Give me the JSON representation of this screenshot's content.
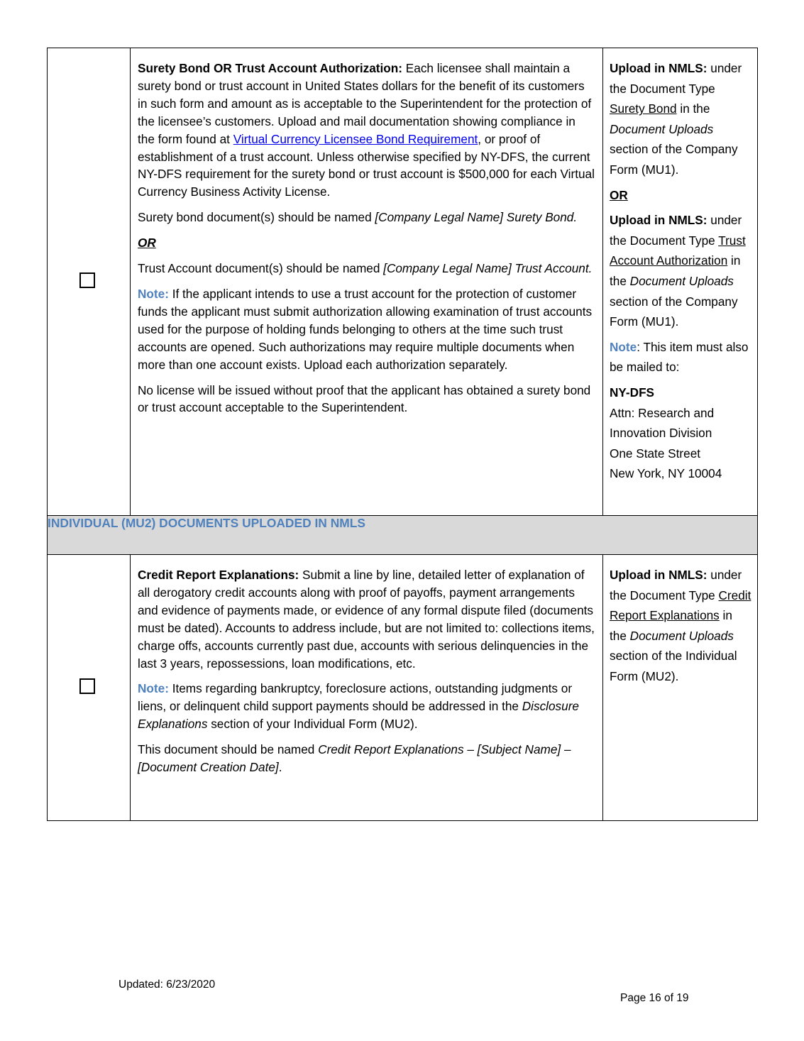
{
  "rows": [
    {
      "checkbox_checked": false,
      "description": {
        "title": "Surety Bond OR Trust Account Authorization:",
        "intro_before_link": " Each licensee shall maintain a surety bond or trust account in United States dollars for the benefit of its customers in such form and amount as is acceptable to the Superintendent for the protection of the licensee’s customers.  Upload and mail documentation showing compliance in the form found at ",
        "link_text": "Virtual Currency Licensee Bond Requirement",
        "intro_after_link": ", or proof of establishment of a trust account.  Unless otherwise specified by NY-DFS, the current NY-DFS requirement for the surety bond or trust account is $500,000 for each Virtual Currency Business Activity License.",
        "surety_naming_prefix": "Surety bond document(s) should be named ",
        "surety_naming_name": "[Company Legal Name] Surety Bond.",
        "or_label": "OR",
        "trust_naming_prefix": "Trust Account document(s) should be named ",
        "trust_naming_name": "[Company Legal Name] Trust Account.",
        "note_label": "Note:",
        "note_text": " If the applicant intends to use a trust account for the protection of customer funds the applicant must submit authorization allowing examination of trust accounts used for the purpose of holding funds belonging to others at the time such trust accounts are opened.  Such authorizations may require multiple documents when more than one account exists.  Upload each authorization separately.",
        "closing": "No license will be issued without proof that the applicant has obtained a surety bond or trust account acceptable to the Superintendent."
      },
      "upload": {
        "label1": "Upload in NMLS:",
        "text1a": " under the Document Type ",
        "doc_type1": "Surety Bond",
        "text1b": " in the ",
        "section1": "Document Uploads",
        "text1c": " section of the Company Form (MU1).",
        "or_label": "OR",
        "label2": "Upload in NMLS:",
        "text2a": " under the Document Type ",
        "doc_type2": "Trust Account Authorization",
        "text2b": " in the ",
        "section2": "Document Uploads",
        "text2c": " section of the Company Form (MU1).",
        "note_label": "Note",
        "note_text": ": This item must also be mailed to:",
        "address": {
          "org": "NY-DFS",
          "line1": "Attn: Research and Innovation Division",
          "line2": "One State Street",
          "line3": "New York, NY 10004"
        }
      }
    },
    {
      "checkbox_checked": false,
      "description": {
        "title": "Credit Report Explanations:",
        "intro": " Submit a line by line, detailed letter of explanation of all derogatory credit accounts along with proof of payoffs, payment arrangements and evidence of payments made, or evidence of any formal dispute filed (documents must be dated).  Accounts to address include, but are not limited to: collections items, charge offs, accounts currently past due, accounts with serious delinquencies in the last 3 years, repossessions, loan modifications, etc.",
        "note_label": "Note:",
        "note_before": " Items regarding bankruptcy, foreclosure actions, outstanding judgments or liens, or delinquent child support payments should be addressed in the ",
        "note_italic": "Disclosure Explanations",
        "note_after": " section of your Individual Form (MU2).",
        "naming_prefix": "This document should be named ",
        "naming_name": "Credit Report Explanations – [Subject Name] – [Document Creation Date]",
        "naming_suffix": "."
      },
      "upload": {
        "label": "Upload in NMLS:",
        "text_a": " under the Document Type ",
        "doc_type": "Credit Report Explanations",
        "text_b": " in the ",
        "section": "Document Uploads",
        "text_c": " section of the Individual Form (MU2)."
      }
    }
  ],
  "section_header": "INDIVIDUAL (MU2) DOCUMENTS UPLOADED IN NMLS",
  "footer": {
    "updated": "Updated: 6/23/2020",
    "page": "Page 16 of 19"
  },
  "colors": {
    "note_blue": "#4f81bd",
    "link_blue": "#0000ee",
    "section_bg": "#d9d9d9"
  }
}
